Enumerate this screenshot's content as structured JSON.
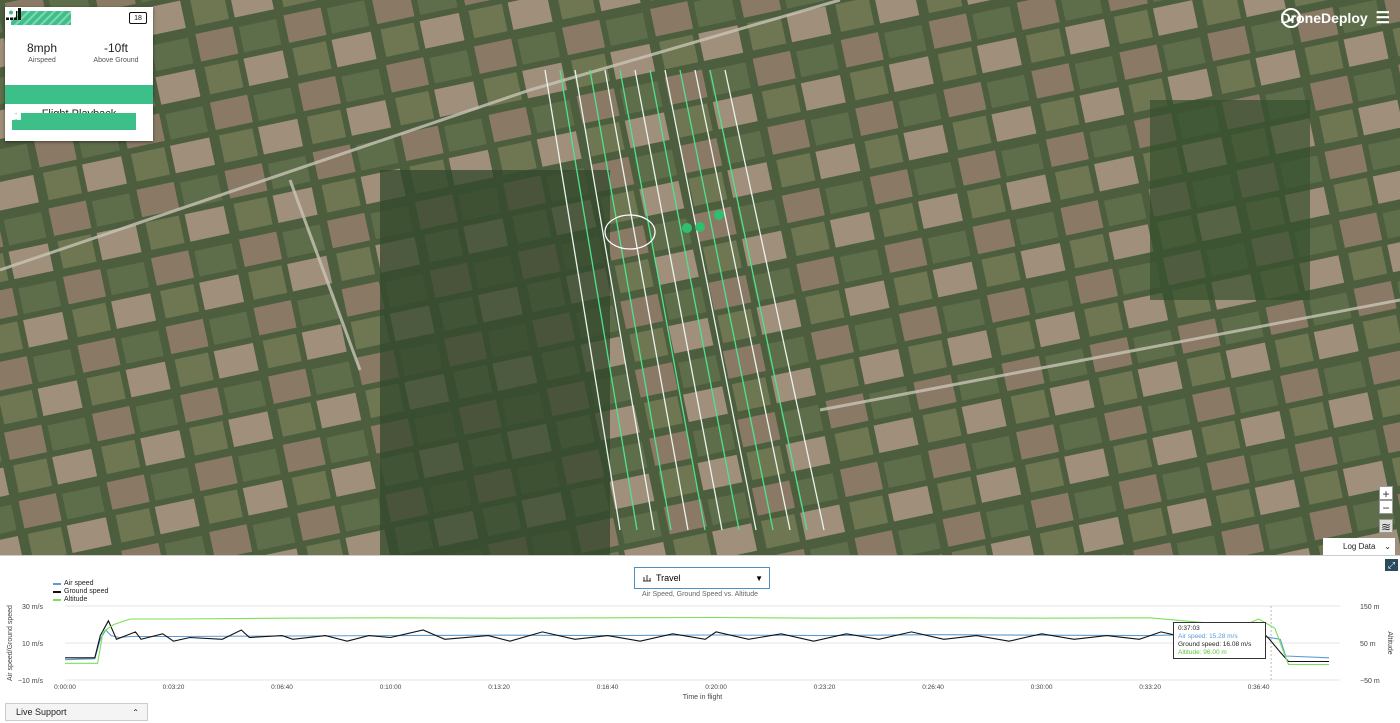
{
  "widget": {
    "battery": "18",
    "airspeed_value": "8mph",
    "airspeed_label": "Airspeed",
    "altitude_value": "-10ft",
    "altitude_label": "Above Ground",
    "tools": [
      "chart-icon",
      "grid-icon",
      "plane-icon",
      "camera-icon"
    ],
    "playback_title": "Flight Playback",
    "playback_buttons": [
      "rewind-start-icon",
      "rewind-icon",
      "pause-icon",
      "play-icon",
      "fast-forward-icon",
      "forward-end-icon"
    ]
  },
  "brand": {
    "name": "DroneDeploy"
  },
  "map_controls": {
    "zoom_in": "+",
    "zoom_out": "−",
    "log_tab": "Log Data"
  },
  "chart_panel": {
    "dropdown_value": "Travel",
    "subtitle": "Air Speed, Ground Speed vs. Altitude",
    "live_support": "Live Support"
  },
  "colors": {
    "accent": "#3dbf8a",
    "air": "#5b9bd5",
    "ground": "#111111",
    "altitude": "#7be05a"
  },
  "chart_data": {
    "type": "line",
    "xlabel": "Time in flight",
    "ylabel": "Air speed/Ground speed",
    "y2label": "Altitude",
    "legend": [
      "Air speed",
      "Ground speed",
      "Altitude"
    ],
    "x_ticks": [
      "0:00:00",
      "0:03:20",
      "0:06:40",
      "0:10:00",
      "0:13:20",
      "0:16:40",
      "0:20:00",
      "0:23:20",
      "0:26:40",
      "0:30:00",
      "0:33:20",
      "0:36:40"
    ],
    "x_tick_seconds": [
      0,
      200,
      400,
      600,
      800,
      1000,
      1200,
      1400,
      1600,
      1800,
      2000,
      2200
    ],
    "y_ticks": [
      "30 m/s",
      "10 m/s",
      "−10 m/s"
    ],
    "y_ticks_values": [
      30,
      10,
      -10
    ],
    "y2_ticks": [
      "150 m",
      "50 m",
      "−50 m"
    ],
    "y2_ticks_values": [
      150,
      50,
      -50
    ],
    "ylim": [
      -10,
      30
    ],
    "y2lim": [
      -50,
      150
    ],
    "xlim": [
      0,
      2350
    ],
    "series": [
      {
        "name": "Air speed",
        "points": [
          [
            0,
            1
          ],
          [
            55,
            1.5
          ],
          [
            65,
            12
          ],
          [
            75,
            17
          ],
          [
            85,
            14
          ],
          [
            100,
            13
          ],
          [
            120,
            13.5
          ],
          [
            200,
            13.5
          ],
          [
            400,
            13.8
          ],
          [
            600,
            14
          ],
          [
            800,
            14.2
          ],
          [
            1000,
            14
          ],
          [
            1200,
            14.3
          ],
          [
            1400,
            14
          ],
          [
            1600,
            14.5
          ],
          [
            1800,
            14.2
          ],
          [
            2000,
            14
          ],
          [
            2170,
            15.28
          ],
          [
            2200,
            14
          ],
          [
            2240,
            12
          ],
          [
            2250,
            3
          ],
          [
            2330,
            2
          ]
        ]
      },
      {
        "name": "Ground speed",
        "points": [
          [
            0,
            2
          ],
          [
            55,
            2
          ],
          [
            65,
            14
          ],
          [
            80,
            22
          ],
          [
            95,
            12
          ],
          [
            130,
            16
          ],
          [
            140,
            12
          ],
          [
            180,
            15
          ],
          [
            200,
            11
          ],
          [
            230,
            13
          ],
          [
            290,
            12
          ],
          [
            325,
            17
          ],
          [
            340,
            13
          ],
          [
            400,
            14
          ],
          [
            420,
            12
          ],
          [
            480,
            14
          ],
          [
            520,
            11
          ],
          [
            560,
            14
          ],
          [
            600,
            13
          ],
          [
            660,
            17
          ],
          [
            700,
            12
          ],
          [
            780,
            14
          ],
          [
            820,
            11
          ],
          [
            880,
            16
          ],
          [
            940,
            12
          ],
          [
            1000,
            14
          ],
          [
            1060,
            11
          ],
          [
            1120,
            15
          ],
          [
            1180,
            12
          ],
          [
            1200,
            16
          ],
          [
            1260,
            12
          ],
          [
            1320,
            15
          ],
          [
            1380,
            11
          ],
          [
            1440,
            15
          ],
          [
            1500,
            12
          ],
          [
            1560,
            16
          ],
          [
            1620,
            12
          ],
          [
            1680,
            14
          ],
          [
            1740,
            11
          ],
          [
            1800,
            15
          ],
          [
            1860,
            12
          ],
          [
            1920,
            14
          ],
          [
            1980,
            12
          ],
          [
            2020,
            16
          ],
          [
            2080,
            12
          ],
          [
            2140,
            14
          ],
          [
            2170,
            16.08
          ],
          [
            2200,
            18
          ],
          [
            2220,
            12
          ],
          [
            2240,
            5
          ],
          [
            2255,
            0
          ],
          [
            2330,
            0
          ]
        ]
      },
      {
        "name": "Altitude",
        "points": [
          [
            0,
            -5
          ],
          [
            60,
            -5
          ],
          [
            70,
            80
          ],
          [
            90,
            100
          ],
          [
            120,
            115
          ],
          [
            200,
            115
          ],
          [
            400,
            117
          ],
          [
            600,
            118
          ],
          [
            800,
            117
          ],
          [
            1000,
            118
          ],
          [
            1200,
            119
          ],
          [
            1400,
            117
          ],
          [
            1600,
            118
          ],
          [
            1800,
            117
          ],
          [
            2000,
            118
          ],
          [
            2170,
            96
          ],
          [
            2200,
            115
          ],
          [
            2230,
            90
          ],
          [
            2245,
            30
          ],
          [
            2255,
            -8
          ],
          [
            2330,
            -8
          ]
        ]
      }
    ],
    "tooltip": {
      "time": "0:37:03",
      "air": "Air speed: 15.28 m/s",
      "ground": "Ground speed: 16.08 m/s",
      "altitude": "Altitude: 96.00 m"
    }
  }
}
